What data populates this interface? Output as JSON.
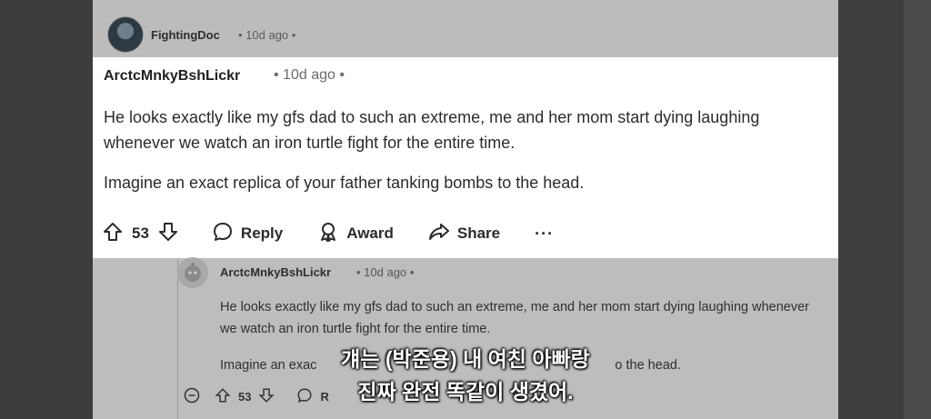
{
  "top_comment": {
    "username": "FightingDoc",
    "meta": "• 10d ago •"
  },
  "highlighted_comment": {
    "username": "ArctcMnkyBshLickr",
    "meta": "• 10d ago •",
    "paragraphs": [
      "He looks exactly like my gfs dad to such an extreme, me and her mom start dying laughing whenever we watch an iron turtle fight for the entire time.",
      "Imagine an exact replica of your father tanking bombs to the head."
    ],
    "vote_count": "53",
    "actions": {
      "reply": "Reply",
      "award": "Award",
      "share": "Share",
      "more": "···"
    }
  },
  "background_reply": {
    "username": "ArctcMnkyBshLickr",
    "meta": "• 10d ago •",
    "paragraphs": [
      "He looks exactly like my gfs dad to such an extreme, me and her mom start dying laughing whenever we watch an iron turtle fight for the entire time.",
      "Imagine an exac",
      "o the head."
    ],
    "vote_count": "53",
    "reply_partial": "R"
  },
  "subtitles": {
    "line1": "걔는 (박준용) 내 여친 아빠랑",
    "line2": "진짜 완전 똑같이 생겼어."
  },
  "colors": {
    "card_bg": "#ffffff",
    "faded_bg": "#bdbdbd",
    "side_bars": "#3c3c3c",
    "subtitle_text": "#ffffff"
  },
  "icons": [
    "upvote-icon",
    "downvote-icon",
    "reply-icon",
    "award-icon",
    "share-icon",
    "more-icon",
    "collapse-icon"
  ]
}
